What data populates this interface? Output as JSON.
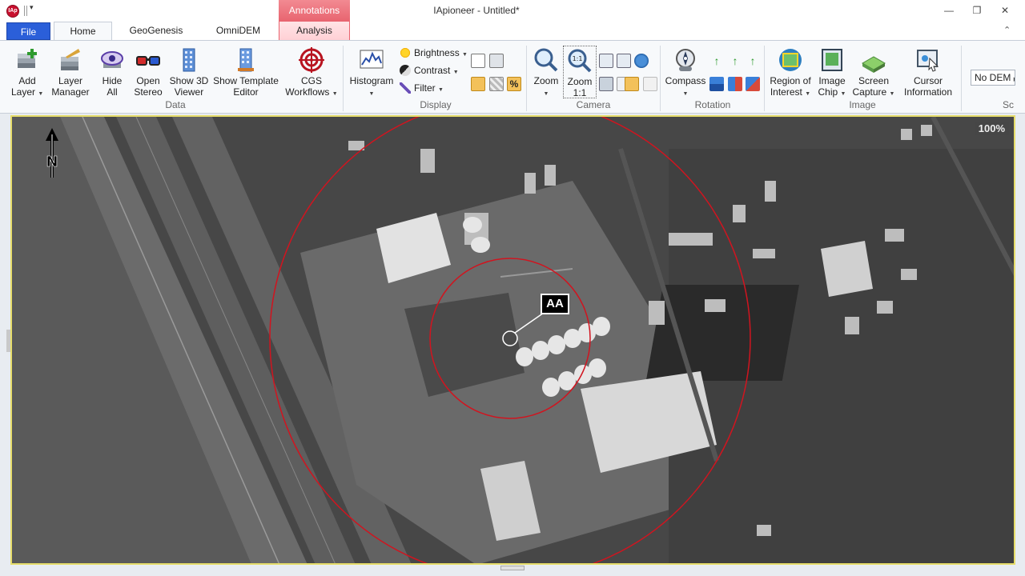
{
  "window": {
    "title": "IApioneer - Untitled*",
    "logo_text": "IAp",
    "minimize_glyph": "—",
    "maximize_glyph": "❐",
    "close_glyph": "✕",
    "collapse_glyph": "⌃",
    "qa_dropdown_glyph": "▾"
  },
  "context_tab": {
    "header": "Annotations"
  },
  "tabs": {
    "file": "File",
    "home": "Home",
    "geogenesis": "GeoGenesis",
    "omnidem": "OmniDEM",
    "analysis": "Analysis"
  },
  "ribbon": {
    "groups": {
      "data": "Data",
      "display": "Display",
      "camera": "Camera",
      "rotation": "Rotation",
      "image": "Image",
      "scale_partial": "Sc"
    },
    "data": {
      "add_layer": [
        "Add",
        "Layer"
      ],
      "layer_manager": [
        "Layer",
        "Manager"
      ],
      "hide_all": [
        "Hide",
        "All"
      ],
      "open_stereo": [
        "Open",
        "Stereo"
      ],
      "show_3d_viewer": [
        "Show 3D",
        "Viewer"
      ],
      "show_template_editor": [
        "Show Template",
        "Editor"
      ],
      "cgs_workflows": [
        "CGS",
        "Workflows"
      ]
    },
    "display": {
      "histogram": "Histogram",
      "brightness": "Brightness",
      "contrast": "Contrast",
      "filter": "Filter"
    },
    "camera": {
      "zoom": "Zoom",
      "zoom_1_1": [
        "Zoom",
        "1:1"
      ],
      "zoom_1_1_icon_text": "1:1"
    },
    "rotation": {
      "compass": "Compass"
    },
    "image": {
      "region_of_interest": [
        "Region of",
        "Interest"
      ],
      "image_chip": [
        "Image",
        "Chip"
      ],
      "screen_capture": [
        "Screen",
        "Capture"
      ],
      "cursor_information": [
        "Cursor",
        "Information"
      ]
    },
    "dem_select": "No DEM"
  },
  "viewer": {
    "zoom_level": "100%",
    "annotation_label": "AA",
    "north_arrow": "N"
  },
  "colors": {
    "file_tab": "#2b5fd9",
    "context_tab": "#e8646f",
    "annotation_circle": "#d1141f",
    "viewer_border": "#e6dd6a"
  }
}
